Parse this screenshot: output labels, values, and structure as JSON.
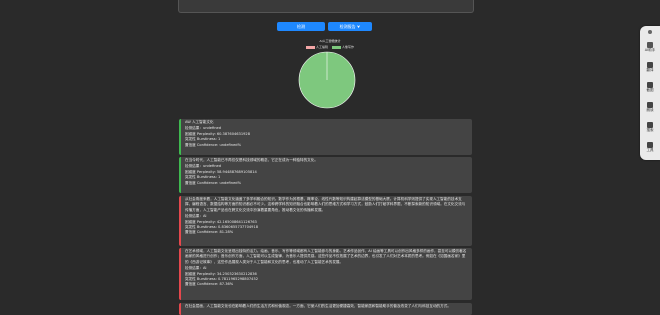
{
  "buttons": {
    "detect": "检测",
    "report": "检测报告 ⮟"
  },
  "chart_data": {
    "type": "pie",
    "title": "AI人工智能统计",
    "legend": [
      "人工编辑",
      "人像写作"
    ],
    "values": [
      0,
      100
    ],
    "colors": [
      "#f3a6a6",
      "#7ec87e"
    ]
  },
  "colors": {
    "human_bar": "#3fb950",
    "ai_bar": "#e5484d",
    "accent": "#1e88ff"
  },
  "cards": [
    {
      "kind": "human",
      "content": "AW 人工智能文化",
      "type_line": "检测结果：undefined",
      "perplexity_line": "困惑度 Perplexity: 60.387604631928",
      "burstiness_line": "突发性 Burstiness: 1",
      "confidence_line": "置信度 Confidence: undefined%"
    },
    {
      "kind": "human",
      "content": "在当今时代，人工智能已不再仅仅是科技领域的概念，它正在成为一种独特的文化。",
      "type_line": "检测结果：undefined",
      "perplexity_line": "困惑度 Perplexity: 58.944887689105814",
      "burstiness_line": "突发性 Burstiness: 1",
      "confidence_line": "置信度 Confidence: undefined%"
    },
    {
      "kind": "ai",
      "content": "从社会角度来看，人工智能文化涵盖了多学科融合的知识。数学作为其根基，概率论、线性代数等知识构建起算法模型的基础大厦。计算机科学则提供了实现人工智能的技术支撑，编程语言、数据结构等方面的知识都必不可少。这种跨学科的知识融合也影响着人们的思维方式和学习方式，鼓励人们打破学科界限，不断探索新的知识领域。在文化交流与传播方面，人工智能产品也在跨文化交流中扮演着重要角色，推动着文化的传播和发展。",
      "type_line": "检测结果：AI",
      "perplexity_line": "困惑度 Perplexity: 42.165008641126763",
      "burstiness_line": "突发性 Burstiness: 0.8360655737704918",
      "confidence_line": "置信度 Confidence: 81.28%"
    },
    {
      "kind": "ai",
      "content": "在艺术领域，人工智能文化呈现出独特的活力。绘画、音乐、写作等领域都有人工智能参与的身影。艺术作品创作、AI 绘画等工具可以创作出风格多样的画作，甚至可以模仿著名画家的风格进行创作；音乐创作方面，人工智能可以生成旋律，为音乐人提供灵感。这些作品不仅拓展了艺术的边界，也引发了人们对艺术本质的思考。例如在《如国画名家》里的《西游记故事》，这些作品展现人类对于人工智能和文化的思考，也推动了人工智能艺术的发展。",
      "type_line": "检测结果：AI",
      "perplexity_line": "困惑度 Perplexity: 34.250323630212836",
      "burstiness_line": "突发性 Burstiness: 0.7811965298807452",
      "confidence_line": "置信度 Confidence: 87.36%"
    },
    {
      "kind": "ai",
      "content": "在社会层面，人工智能文化也在影响着人们的生活方式和价值观念。一方面，它使人们的生活更加便捷高效，智能家居和智能助手的普及改变了人们与科技互动的方式。",
      "type_line": "",
      "perplexity_line": "",
      "burstiness_line": "",
      "confidence_line": ""
    }
  ],
  "dock": [
    {
      "icon": "dock-handle-icon",
      "label": ""
    },
    {
      "icon": "ai-assistant-icon",
      "label": "AI助手"
    },
    {
      "icon": "translate-icon",
      "label": "翻译"
    },
    {
      "icon": "screenshot-icon",
      "label": "截图"
    },
    {
      "icon": "read-aloud-icon",
      "label": "朗读"
    },
    {
      "icon": "search-icon",
      "label": "搜索"
    },
    {
      "icon": "tools-icon",
      "label": "工具"
    }
  ]
}
